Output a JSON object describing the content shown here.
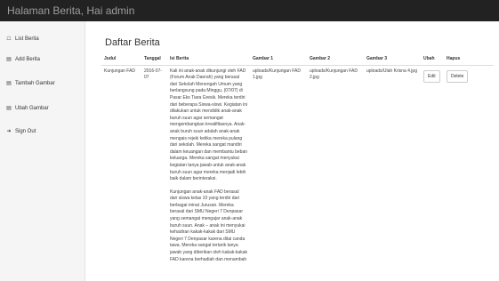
{
  "header": {
    "title": "Halaman Berita, Hai admin"
  },
  "sidebar": {
    "items": [
      {
        "label": "List Berita",
        "icon": "home-icon"
      },
      {
        "label": "Add Berita",
        "icon": "database-icon"
      },
      {
        "label": "Tambah Gambar",
        "icon": "database-icon"
      },
      {
        "label": "Ubah Gambar",
        "icon": "database-icon"
      },
      {
        "label": "Sign Out",
        "icon": "sign-out-icon"
      }
    ]
  },
  "main": {
    "title": "Daftar Berita",
    "columns": [
      "Judul",
      "Tanggal",
      "Isi Berita",
      "Gambar 1",
      "Gambar 2",
      "Gambar 3",
      "Ubah",
      "Hapus"
    ],
    "rows": [
      {
        "judul": "Kunjungan FAD",
        "tanggal": "2016-07-07",
        "isi_p1": "Kali ini anak-anak dikunjungi oleh FAD (Forum Anak Daerah) yang berasal dari Sekolah Menengah Umum yang berlangsung pada Minggu, (07/07) di Pasar Eks Tiara Gresik. Mereka terdiri dari beberapa Siswa-siswi. Kegiatan ini dilakukan untuk mendidik anak-anak buruh suun agar semangat mengembangkan kreatifitasnya. Anak-anak buruh suun adalah anak-anak mengais rejeki ketika mereka pulang dari sekolah. Mereka sangat mandiri dalam keuangan dan membantu beban keluarga. Mereka sangat menyukai kegiatan tanya jawab untuk anak-anak buruh suun agar mereka menjadi lebih baik dalam berinteraksi.",
        "isi_p2": "Kunjungan anak-anak FAD berasal dari siswa kelas 10 yang terdiri dari berbagai minat Jurusan. Mereka berasal dari SMU Negeri 7 Denpasar yang semangat mengajar anak-anak buruh suun. Anak – anak ini menyukai kehadiran kakak-kakak dari SMU Negeri 7 Denpasar karena ditai canda tawa. Mereka sangat tertarik tanya jawab yang diberikan oleh kakak-kakak FAD karena berhadiah dan menambah",
        "gambar1": "uploads/Kunjungan FAD 1.jpg",
        "gambar2": "uploads/Kunjungan FAD 2.jpg",
        "gambar3": "uploads/Ulah Krisna 4.jpg",
        "edit_label": "Edit",
        "delete_label": "Delete"
      }
    ]
  }
}
